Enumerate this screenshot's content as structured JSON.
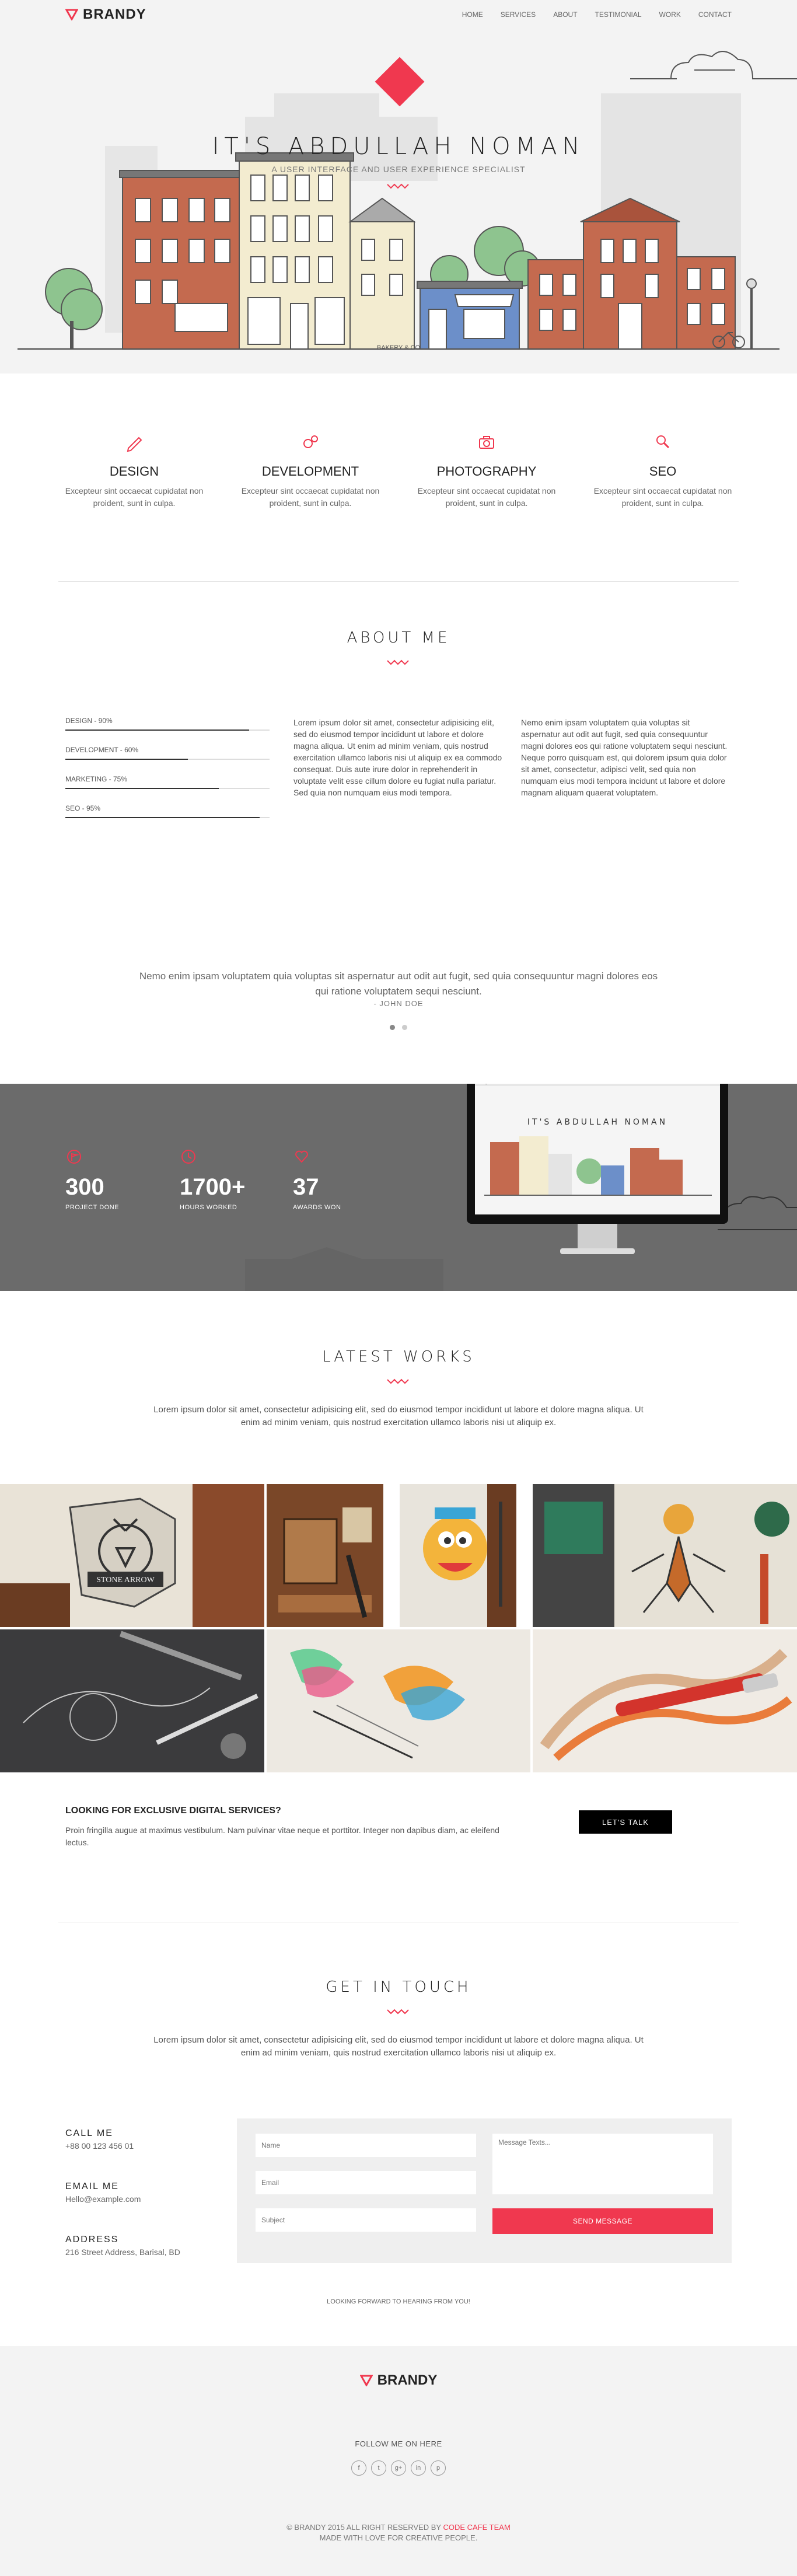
{
  "header": {
    "brand": "BRANDY",
    "nav": [
      "HOME",
      "SERVICES",
      "ABOUT",
      "TESTIMONIAL",
      "WORK",
      "CONTACT"
    ]
  },
  "hero": {
    "title": "IT'S ABDULLAH NOMAN",
    "subtitle": "A USER INTERFACE AND USER EXPERIENCE SPECIALIST",
    "caption": "BAKERY & CO"
  },
  "services": [
    {
      "icon": "pencil-icon",
      "title": "DESIGN",
      "text": "Excepteur sint occaecat cupidatat non proident, sunt in culpa."
    },
    {
      "icon": "gears-icon",
      "title": "DEVELOPMENT",
      "text": "Excepteur sint occaecat cupidatat non proident, sunt in culpa."
    },
    {
      "icon": "camera-icon",
      "title": "PHOTOGRAPHY",
      "text": "Excepteur sint occaecat cupidatat non proident, sunt in culpa."
    },
    {
      "icon": "search-icon",
      "title": "SEO",
      "text": "Excepteur sint occaecat cupidatat non proident, sunt in culpa."
    }
  ],
  "about": {
    "title": "ABOUT ME",
    "skills": [
      {
        "label": "DESIGN - 90%",
        "value": 0.9
      },
      {
        "label": "DEVELOPMENT - 60%",
        "value": 0.6
      },
      {
        "label": "MARKETING - 75%",
        "value": 0.75
      },
      {
        "label": "SEO - 95%",
        "value": 0.95
      }
    ],
    "col1": "Lorem ipsum dolor sit amet, consectetur adipisicing elit, sed do eiusmod tempor incididunt ut labore et dolore magna aliqua. Ut enim ad minim veniam, quis nostrud exercitation ullamco laboris nisi ut aliquip ex ea commodo consequat. Duis aute irure dolor in reprehenderit in voluptate velit esse cillum dolore eu fugiat nulla pariatur. Sed quia non numquam eius modi tempora.",
    "col2": "Nemo enim ipsam voluptatem quia voluptas sit aspernatur aut odit aut fugit, sed quia consequuntur magni dolores eos qui ratione voluptatem sequi nesciunt. Neque porro quisquam est, qui dolorem ipsum quia dolor sit amet, consectetur, adipisci velit, sed quia non numquam eius modi tempora incidunt ut labore et dolore magnam aliquam quaerat voluptatem."
  },
  "testimonial": {
    "quote": "Nemo enim ipsam voluptatem quia voluptas sit aspernatur aut odit aut fugit, sed quia consequuntur magni dolores eos qui ratione voluptatem sequi nesciunt.",
    "author": "- JOHN DOE"
  },
  "stats": [
    {
      "icon": "flag-icon",
      "number": "300",
      "label": "PROJECT DONE"
    },
    {
      "icon": "clock-icon",
      "number": "1700+",
      "label": "HOURS WORKED"
    },
    {
      "icon": "heart-icon",
      "number": "37",
      "label": "AWARDS WON"
    }
  ],
  "works": {
    "title": "LATEST WORKS",
    "text": "Lorem ipsum dolor sit amet, consectetur adipisicing elit, sed do eiusmod tempor incididunt ut labore et dolore magna aliqua. Ut enim ad minim veniam, quis nostrud exercitation ullamco laboris nisi ut aliquip ex.",
    "stamp": "STONE ARROW"
  },
  "cta": {
    "title": "LOOKING FOR EXCLUSIVE DIGITAL SERVICES?",
    "text": "Proin fringilla augue at maximus vestibulum. Nam pulvinar vitae neque et porttitor. Integer non dapibus diam, ac eleifend lectus.",
    "button": "LET'S TALK"
  },
  "contact": {
    "title": "GET IN TOUCH",
    "text": "Lorem ipsum dolor sit amet, consectetur adipisicing elit, sed do eiusmod tempor incididunt ut labore et dolore magna aliqua. Ut enim ad minim veniam, quis nostrud exercitation ullamco laboris nisi ut aliquip ex.",
    "call_title": "CALL ME",
    "call_value": "+88 00 123 456 01",
    "email_title": "EMAIL ME",
    "email_value": "Hello@example.com",
    "address_title": "ADDRESS",
    "address_value": "216 Street Address, Barisal, BD",
    "name_placeholder": "Name",
    "email_placeholder": "Email",
    "subject_placeholder": "Subject",
    "message_placeholder": "Message Texts...",
    "send": "SEND MESSAGE",
    "note": "LOOKING FORWARD TO HEARING FROM YOU!"
  },
  "footer": {
    "brand": "BRANDY",
    "follow": "FOLLOW ME ON HERE",
    "socials": [
      "f",
      "t",
      "g+",
      "in",
      "p"
    ],
    "copy_prefix": "© BRANDY 2015 ALL RIGHT RESERVED BY ",
    "copy_team": "CODE CAFE TEAM",
    "made": "MADE WITH LOVE FOR CREATIVE PEOPLE."
  },
  "colors": {
    "accent": "#f0384f",
    "dark": "#222222",
    "stats_bg": "#6b6b6b"
  }
}
